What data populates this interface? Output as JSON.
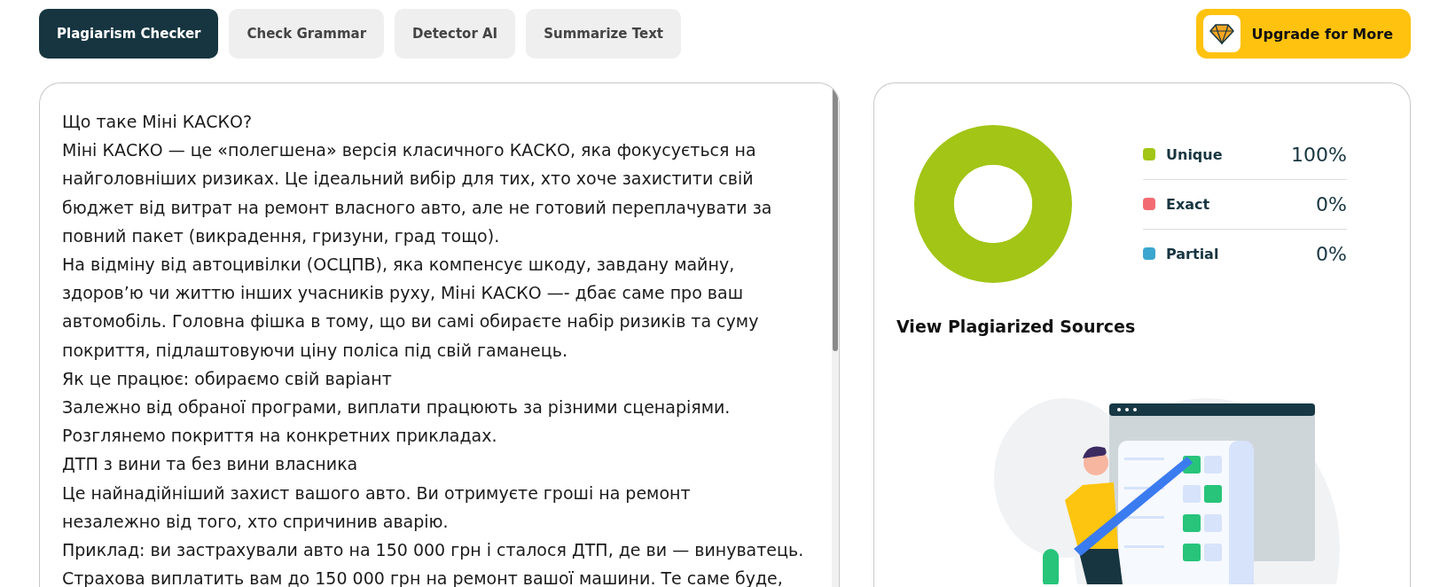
{
  "tabs": [
    {
      "label": "Plagiarism Checker",
      "selected": true
    },
    {
      "label": "Check Grammar",
      "selected": false
    },
    {
      "label": "Detector AI",
      "selected": false
    },
    {
      "label": "Summarize Text",
      "selected": false
    }
  ],
  "upgrade_button": {
    "label": "Upgrade for More"
  },
  "editor": {
    "paragraphs": [
      {
        "lines": [
          "Що таке Міні КАСКО?"
        ]
      },
      {
        "lines": [
          "Міні КАСКО — це «полегшена» версія класичного КАСКО, яка фокусується на",
          "найголовніших ризиках. Це ідеальний вибір для тих, хто хоче захистити свій",
          "бюджет від витрат на ремонт власного авто, але не готовий переплачувати за",
          "повний пакет (викрадення, гризуни, град тощо)."
        ]
      },
      {
        "lines": [
          "На відміну від автоцивілки (ОСЦПВ), яка компенсує шкоду, завдану майну,",
          "здоров’ю чи життю інших учасників руху, Міні КАСКО —- дбає саме про ваш",
          "автомобіль. Головна фішка в тому, що ви самі обираєте набір ризиків та суму",
          "покриття, підлаштовуючи ціну поліса під свій гаманець."
        ]
      },
      {
        "lines": [
          "Як це працює: обираємо свій варіант"
        ]
      },
      {
        "lines": [
          "Залежно від обраної програми, виплати працюють за різними сценаріями.",
          "Розглянемо покриття на конкретних прикладах."
        ]
      },
      {
        "lines": [
          "ДТП з вини та без вини власника"
        ]
      },
      {
        "lines": [
          "Це найнадійніший захист вашого авто. Ви отримуєте гроші на ремонт",
          "незалежно від того, хто спричинив аварію."
        ]
      },
      {
        "lines": [
          "Приклад: ви застрахували авто на 150 000 грн і сталося ДТП, де ви — винуватець.",
          "Страхова виплатить вам до 150 000 грн на ремонт вашої машини. Те саме буде,"
        ]
      }
    ]
  },
  "results": {
    "legend": [
      {
        "value": "100%",
        "color": "#a2c516"
      },
      {
        "value": "0%",
        "color": "#f36b72"
      },
      {
        "value": "0%",
        "color": "#3ba6cf"
      }
    ],
    "chart_data": {
      "type": "donut",
      "categories": [
        "Unique",
        "Exact",
        "Partial"
      ],
      "values": [
        100,
        0,
        0
      ]
    },
    "sources_heading": "View Plagiarized Sources"
  }
}
